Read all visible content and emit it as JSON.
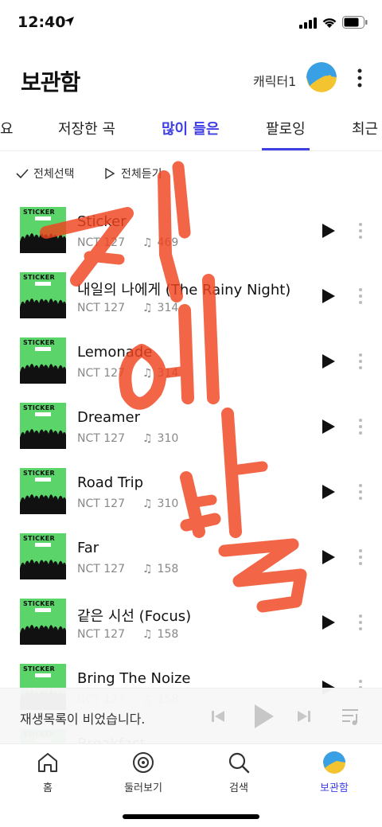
{
  "status_bar": {
    "time": "12:40"
  },
  "header": {
    "title": "보관함",
    "character": "캐릭터1"
  },
  "tabs": [
    {
      "label": "요"
    },
    {
      "label": "저장한 곡"
    },
    {
      "label": "많이 들은",
      "active": true
    },
    {
      "label": "팔로잉"
    },
    {
      "label": "최근"
    }
  ],
  "actions": {
    "select_all": "전체선택",
    "play_all": "전체듣기"
  },
  "songs": [
    {
      "title": "Sticker",
      "artist": "NCT 127",
      "plays": "469"
    },
    {
      "title": "내일의 나에게 (The Rainy Night)",
      "artist": "NCT 127",
      "plays": "314"
    },
    {
      "title": "Lemonade",
      "artist": "NCT 127",
      "plays": "314"
    },
    {
      "title": "Dreamer",
      "artist": "NCT 127",
      "plays": "310"
    },
    {
      "title": "Road Trip",
      "artist": "NCT 127",
      "plays": "310"
    },
    {
      "title": "Far",
      "artist": "NCT 127",
      "plays": "158"
    },
    {
      "title": "같은 시선 (Focus)",
      "artist": "NCT 127",
      "plays": "158"
    },
    {
      "title": "Bring The Noize",
      "artist": "NCT 127",
      "plays": "158"
    },
    {
      "title": "Breakfast",
      "artist": "NCT 127",
      "plays": ""
    }
  ],
  "album_label": "STICKER",
  "mini_player": {
    "status": "재생목록이 비었습니다."
  },
  "nav": [
    {
      "label": "홈",
      "icon": "home-icon"
    },
    {
      "label": "둘러보기",
      "icon": "browse-icon"
    },
    {
      "label": "검색",
      "icon": "search-icon"
    },
    {
      "label": "보관함",
      "icon": "library-icon",
      "active": true
    }
  ],
  "graffiti": [
    "제",
    "에",
    "발"
  ],
  "colors": {
    "accent": "#3f3fe6",
    "graffiti": "#f0441f",
    "cover": "#5bd46a"
  }
}
